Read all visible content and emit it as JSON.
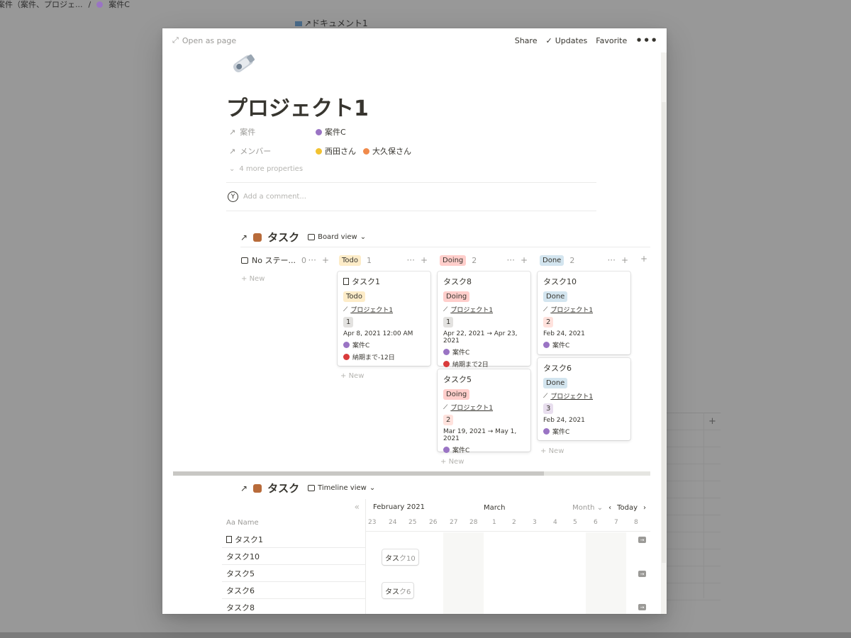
{
  "background": {
    "breadcrumb": [
      "案件（案件、プロジェ...",
      "/",
      "案件C"
    ],
    "doc_title": "↗ドキュメント1"
  },
  "topbar": {
    "open_as_page": "Open as page",
    "share": "Share",
    "updates": "Updates",
    "favorite": "Favorite",
    "more": "•••"
  },
  "page": {
    "title": "プロジェクト1",
    "properties": [
      {
        "name": "案件",
        "values": [
          "案件C"
        ]
      },
      {
        "name": "メンバー",
        "values": [
          "西田さん",
          "大久保さん"
        ]
      }
    ],
    "more_properties": "4 more properties",
    "comment_avatar": "Y",
    "comment_placeholder": "Add a comment..."
  },
  "board": {
    "title": "タスク",
    "view": "Board view",
    "new_label": "New",
    "columns": [
      {
        "label": "No ステー...",
        "count": "0"
      },
      {
        "label": "Todo",
        "count": "1"
      },
      {
        "label": "Doing",
        "count": "2"
      },
      {
        "label": "Done",
        "count": "2"
      }
    ],
    "cards": [
      {
        "title": "タスク1",
        "status": "Todo",
        "project": "プロジェクト1",
        "num": "1",
        "date": "Apr 8, 2021 12:00 AM",
        "case": "案件C",
        "note": "納期まで-12日"
      },
      {
        "title": "タスク8",
        "status": "Doing",
        "project": "プロジェクト1",
        "num": "1",
        "date": "Apr 22, 2021 → Apr 23, 2021",
        "case": "案件C",
        "note": "納期まで2日"
      },
      {
        "title": "タスク5",
        "status": "Doing",
        "project": "プロジェクト1",
        "num": "2",
        "date": "Mar 19, 2021 → May 1, 2021",
        "case": "案件C"
      },
      {
        "title": "タスク10",
        "status": "Done",
        "project": "プロジェクト1",
        "num": "2",
        "date": "Feb 24, 2021",
        "case": "案件C"
      },
      {
        "title": "タスク6",
        "status": "Done",
        "project": "プロジェクト1",
        "num": "3",
        "date": "Feb 24, 2021",
        "case": "案件C"
      }
    ]
  },
  "timeline": {
    "title": "タスク",
    "view": "Timeline view",
    "month1": "February 2021",
    "month2": "March",
    "scale": "Month",
    "today": "Today",
    "name_header": "Name",
    "collapse": "«",
    "days": [
      "23",
      "24",
      "25",
      "26",
      "27",
      "28",
      "1",
      "2",
      "3",
      "4",
      "5",
      "6",
      "7",
      "8"
    ],
    "rows": [
      "タスク1",
      "タスク10",
      "タスク5",
      "タスク6",
      "タスク8"
    ],
    "bars": [
      {
        "inner": "タス",
        "outer": "ク10"
      },
      {
        "inner": "タス",
        "outer": "ク6"
      }
    ]
  },
  "colors": {
    "todo": "#fdecc8",
    "doing": "#ffcecb",
    "done": "#d3e5ef",
    "overlay": "#989898"
  }
}
